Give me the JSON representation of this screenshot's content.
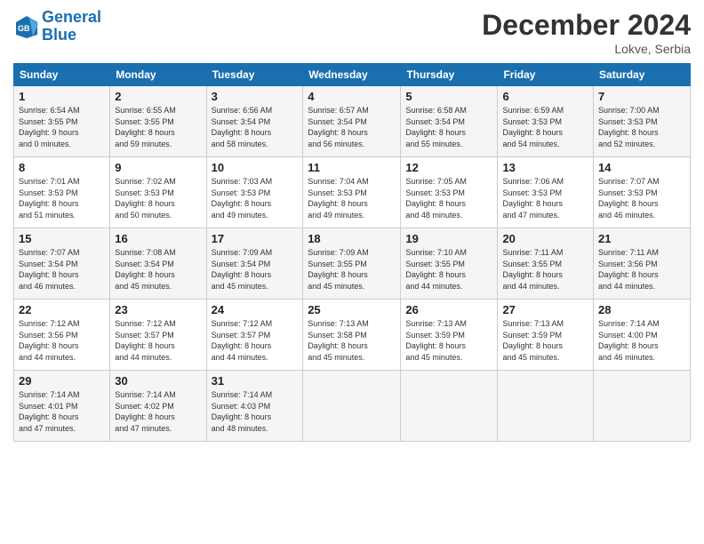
{
  "logo": {
    "line1": "General",
    "line2": "Blue"
  },
  "title": "December 2024",
  "location": "Lokve, Serbia",
  "days_header": [
    "Sunday",
    "Monday",
    "Tuesday",
    "Wednesday",
    "Thursday",
    "Friday",
    "Saturday"
  ],
  "weeks": [
    [
      {
        "day": "1",
        "info": "Sunrise: 6:54 AM\nSunset: 3:55 PM\nDaylight: 9 hours\nand 0 minutes."
      },
      {
        "day": "2",
        "info": "Sunrise: 6:55 AM\nSunset: 3:55 PM\nDaylight: 8 hours\nand 59 minutes."
      },
      {
        "day": "3",
        "info": "Sunrise: 6:56 AM\nSunset: 3:54 PM\nDaylight: 8 hours\nand 58 minutes."
      },
      {
        "day": "4",
        "info": "Sunrise: 6:57 AM\nSunset: 3:54 PM\nDaylight: 8 hours\nand 56 minutes."
      },
      {
        "day": "5",
        "info": "Sunrise: 6:58 AM\nSunset: 3:54 PM\nDaylight: 8 hours\nand 55 minutes."
      },
      {
        "day": "6",
        "info": "Sunrise: 6:59 AM\nSunset: 3:53 PM\nDaylight: 8 hours\nand 54 minutes."
      },
      {
        "day": "7",
        "info": "Sunrise: 7:00 AM\nSunset: 3:53 PM\nDaylight: 8 hours\nand 52 minutes."
      }
    ],
    [
      {
        "day": "8",
        "info": "Sunrise: 7:01 AM\nSunset: 3:53 PM\nDaylight: 8 hours\nand 51 minutes."
      },
      {
        "day": "9",
        "info": "Sunrise: 7:02 AM\nSunset: 3:53 PM\nDaylight: 8 hours\nand 50 minutes."
      },
      {
        "day": "10",
        "info": "Sunrise: 7:03 AM\nSunset: 3:53 PM\nDaylight: 8 hours\nand 49 minutes."
      },
      {
        "day": "11",
        "info": "Sunrise: 7:04 AM\nSunset: 3:53 PM\nDaylight: 8 hours\nand 49 minutes."
      },
      {
        "day": "12",
        "info": "Sunrise: 7:05 AM\nSunset: 3:53 PM\nDaylight: 8 hours\nand 48 minutes."
      },
      {
        "day": "13",
        "info": "Sunrise: 7:06 AM\nSunset: 3:53 PM\nDaylight: 8 hours\nand 47 minutes."
      },
      {
        "day": "14",
        "info": "Sunrise: 7:07 AM\nSunset: 3:53 PM\nDaylight: 8 hours\nand 46 minutes."
      }
    ],
    [
      {
        "day": "15",
        "info": "Sunrise: 7:07 AM\nSunset: 3:54 PM\nDaylight: 8 hours\nand 46 minutes."
      },
      {
        "day": "16",
        "info": "Sunrise: 7:08 AM\nSunset: 3:54 PM\nDaylight: 8 hours\nand 45 minutes."
      },
      {
        "day": "17",
        "info": "Sunrise: 7:09 AM\nSunset: 3:54 PM\nDaylight: 8 hours\nand 45 minutes."
      },
      {
        "day": "18",
        "info": "Sunrise: 7:09 AM\nSunset: 3:55 PM\nDaylight: 8 hours\nand 45 minutes."
      },
      {
        "day": "19",
        "info": "Sunrise: 7:10 AM\nSunset: 3:55 PM\nDaylight: 8 hours\nand 44 minutes."
      },
      {
        "day": "20",
        "info": "Sunrise: 7:11 AM\nSunset: 3:55 PM\nDaylight: 8 hours\nand 44 minutes."
      },
      {
        "day": "21",
        "info": "Sunrise: 7:11 AM\nSunset: 3:56 PM\nDaylight: 8 hours\nand 44 minutes."
      }
    ],
    [
      {
        "day": "22",
        "info": "Sunrise: 7:12 AM\nSunset: 3:56 PM\nDaylight: 8 hours\nand 44 minutes."
      },
      {
        "day": "23",
        "info": "Sunrise: 7:12 AM\nSunset: 3:57 PM\nDaylight: 8 hours\nand 44 minutes."
      },
      {
        "day": "24",
        "info": "Sunrise: 7:12 AM\nSunset: 3:57 PM\nDaylight: 8 hours\nand 44 minutes."
      },
      {
        "day": "25",
        "info": "Sunrise: 7:13 AM\nSunset: 3:58 PM\nDaylight: 8 hours\nand 45 minutes."
      },
      {
        "day": "26",
        "info": "Sunrise: 7:13 AM\nSunset: 3:59 PM\nDaylight: 8 hours\nand 45 minutes."
      },
      {
        "day": "27",
        "info": "Sunrise: 7:13 AM\nSunset: 3:59 PM\nDaylight: 8 hours\nand 45 minutes."
      },
      {
        "day": "28",
        "info": "Sunrise: 7:14 AM\nSunset: 4:00 PM\nDaylight: 8 hours\nand 46 minutes."
      }
    ],
    [
      {
        "day": "29",
        "info": "Sunrise: 7:14 AM\nSunset: 4:01 PM\nDaylight: 8 hours\nand 47 minutes."
      },
      {
        "day": "30",
        "info": "Sunrise: 7:14 AM\nSunset: 4:02 PM\nDaylight: 8 hours\nand 47 minutes."
      },
      {
        "day": "31",
        "info": "Sunrise: 7:14 AM\nSunset: 4:03 PM\nDaylight: 8 hours\nand 48 minutes."
      },
      null,
      null,
      null,
      null
    ]
  ]
}
